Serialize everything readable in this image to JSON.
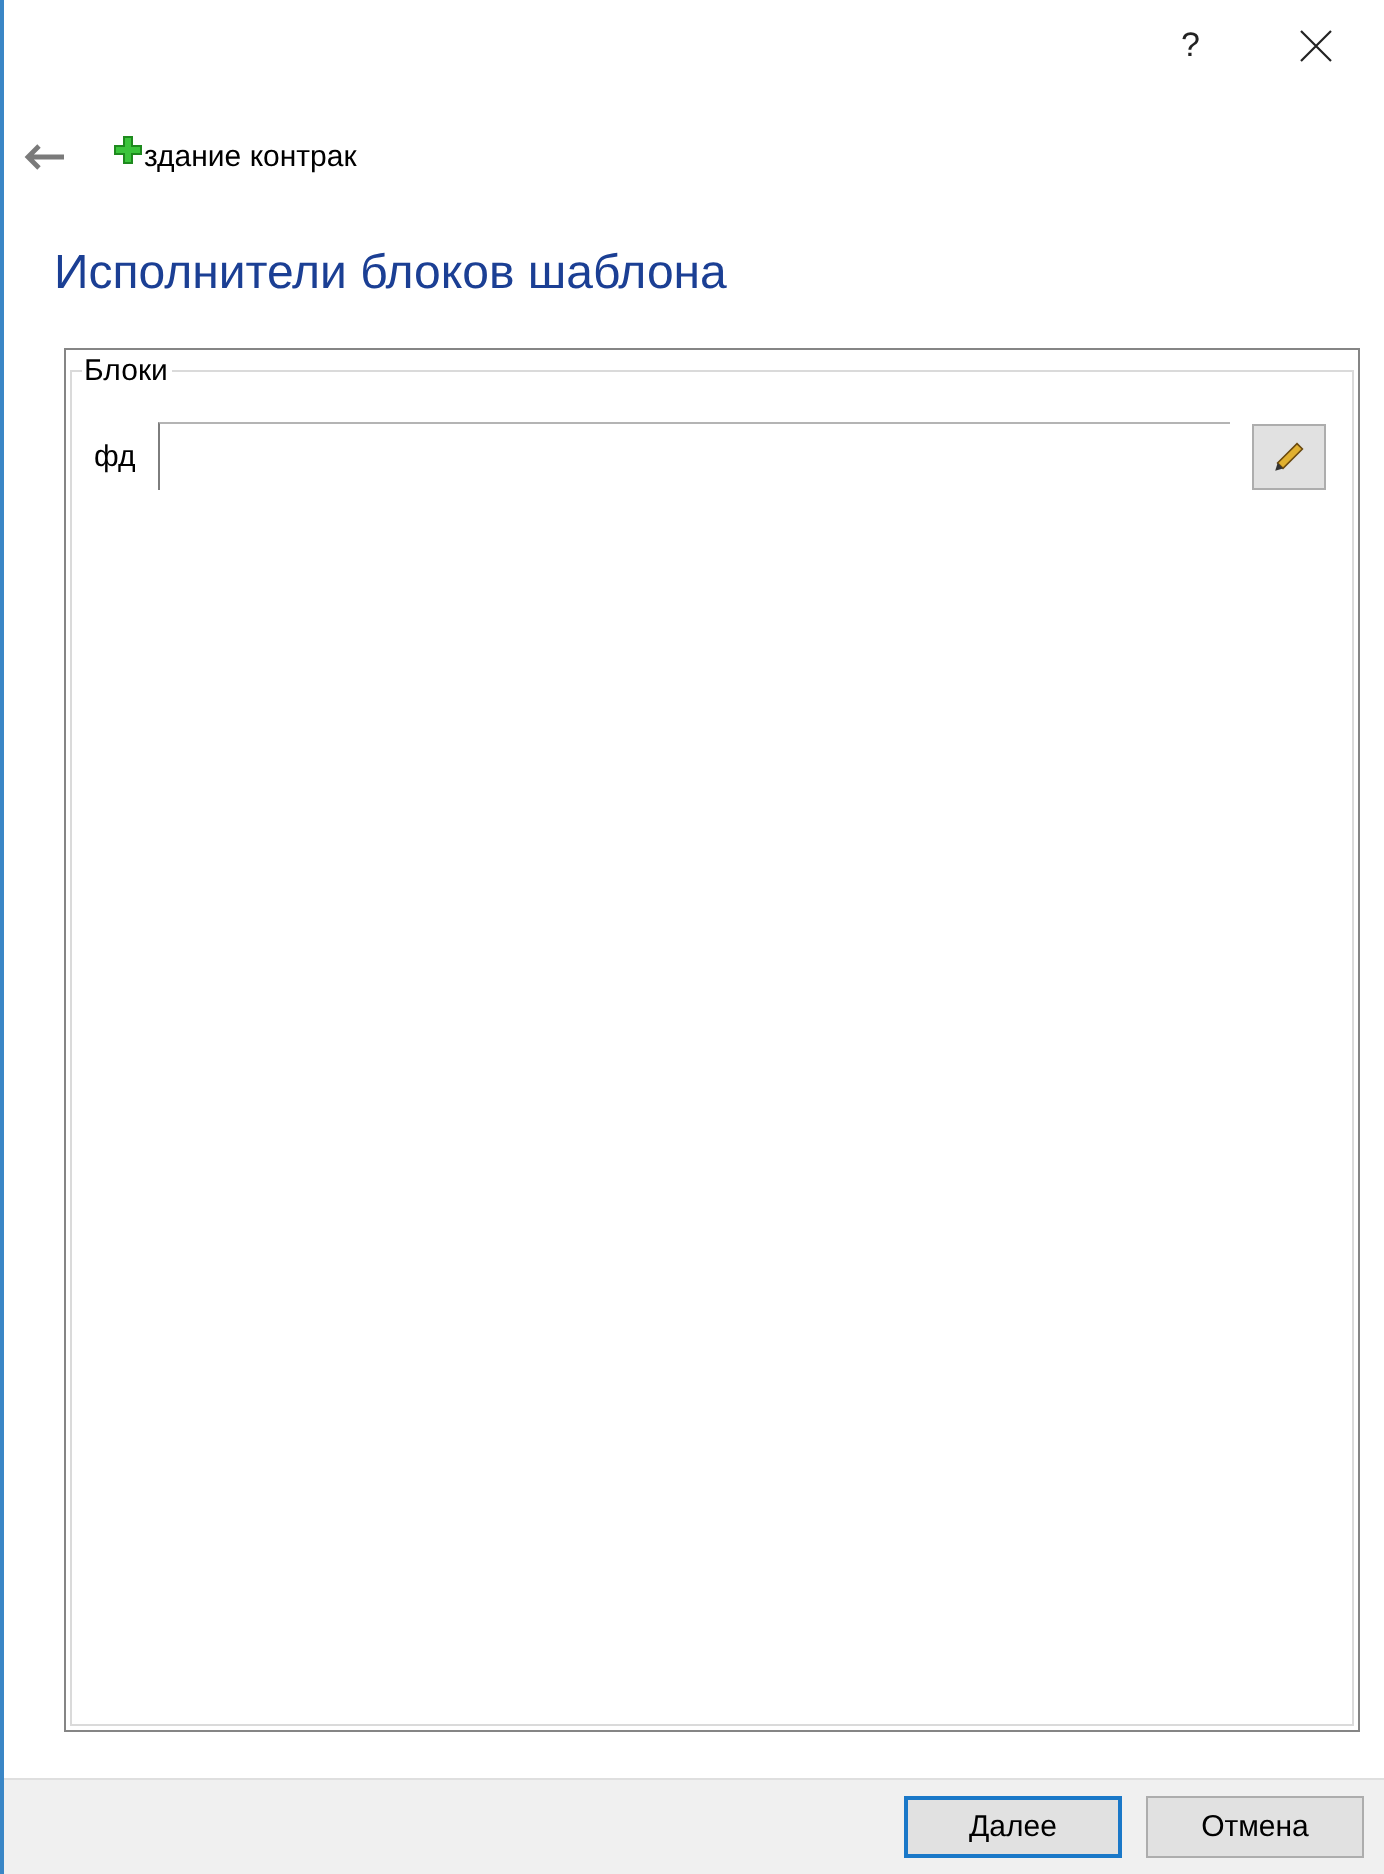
{
  "window": {
    "help": "?"
  },
  "header": {
    "title": "здание контрак"
  },
  "heading": "Исполнители блоков шаблона",
  "group": {
    "legend": "Блоки",
    "fields": [
      {
        "label": "фд"
      }
    ]
  },
  "buttons": [
    {
      "label": "Далее",
      "default": true
    },
    {
      "label": "Отмена",
      "default": false
    }
  ]
}
